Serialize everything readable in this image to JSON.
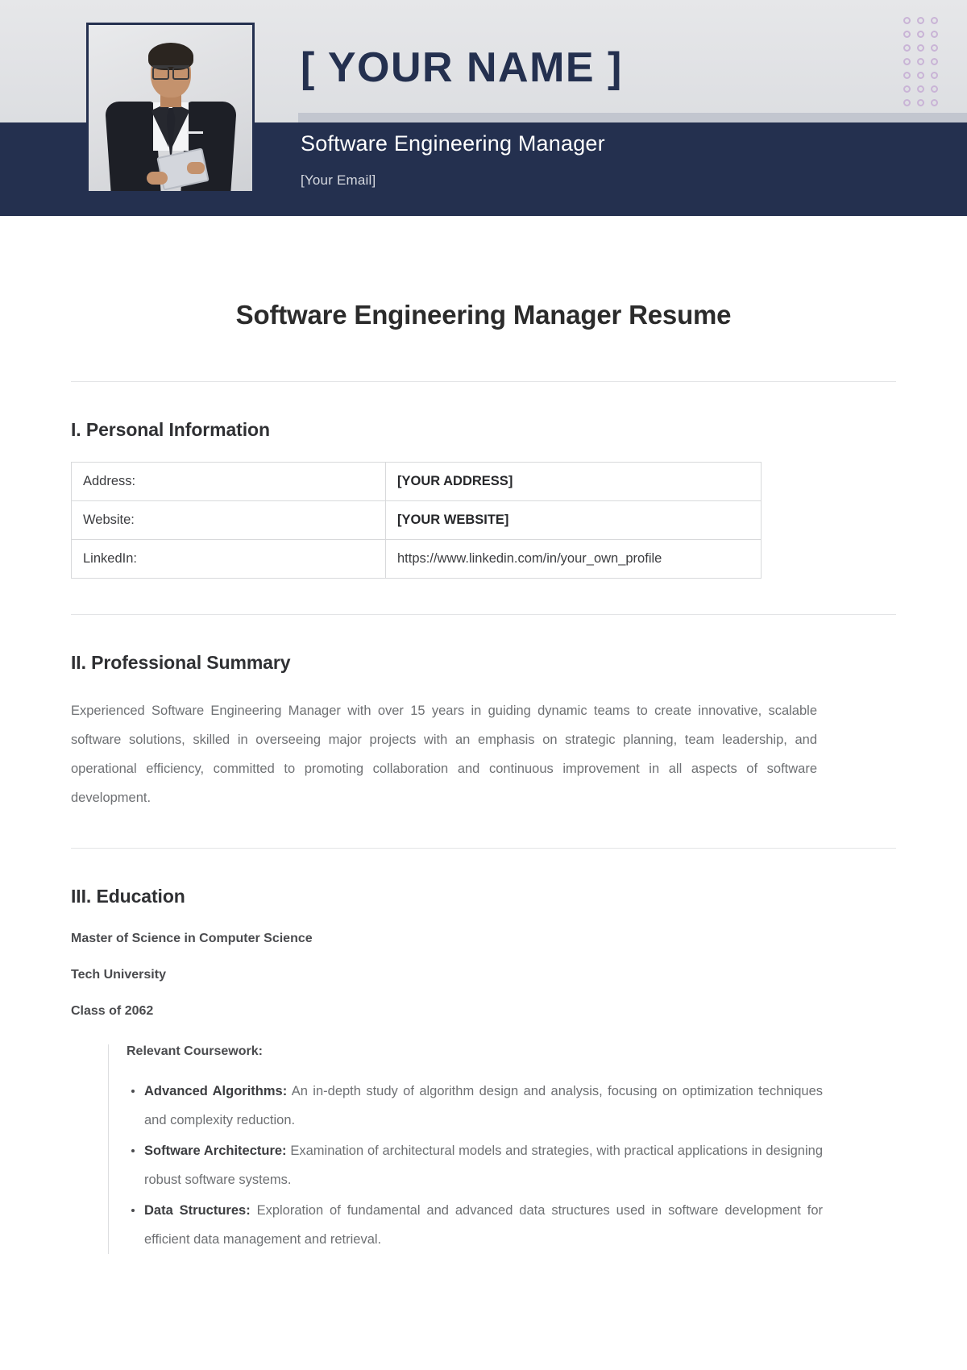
{
  "header": {
    "name": "[ YOUR NAME ]",
    "job_title": "Software Engineering Manager",
    "email": "[Your Email]",
    "navy_color": "#24304f",
    "dot_color": "#c9b4d6",
    "dot_columns": 3,
    "dot_rows": 7,
    "photo_alt": "portrait-photo"
  },
  "document": {
    "title": "Software Engineering Manager Resume"
  },
  "sections": {
    "personal_information": {
      "heading": "I. Personal Information",
      "rows": [
        {
          "label": "Address:",
          "value": "[YOUR ADDRESS]",
          "bold": true
        },
        {
          "label": "Website:",
          "value": "[YOUR WEBSITE]",
          "bold": true
        },
        {
          "label": "LinkedIn:",
          "value": "https://www.linkedin.com/in/your_own_profile",
          "bold": false
        }
      ]
    },
    "professional_summary": {
      "heading": "II. Professional Summary",
      "text": "Experienced Software Engineering Manager with over 15 years in guiding dynamic teams to create innovative, scalable software solutions, skilled in overseeing major projects with an emphasis on strategic planning, team leadership, and operational efficiency, committed to promoting collaboration and continuous improvement in all aspects of software development."
    },
    "education": {
      "heading": "III. Education",
      "degree": "Master of Science in Computer Science",
      "school": "Tech University",
      "class_year": "Class of 2062",
      "coursework_label": "Relevant Coursework:",
      "coursework": [
        {
          "term": "Advanced Algorithms:",
          "description": " An in-depth study of algorithm design and analysis, focusing on optimization techniques and complexity reduction."
        },
        {
          "term": "Software Architecture:",
          "description": " Examination of architectural models and strategies, with practical applications in designing robust software systems."
        },
        {
          "term": "Data Structures:",
          "description": " Exploration of fundamental and advanced data structures used in software development for efficient data management and retrieval."
        }
      ]
    }
  }
}
